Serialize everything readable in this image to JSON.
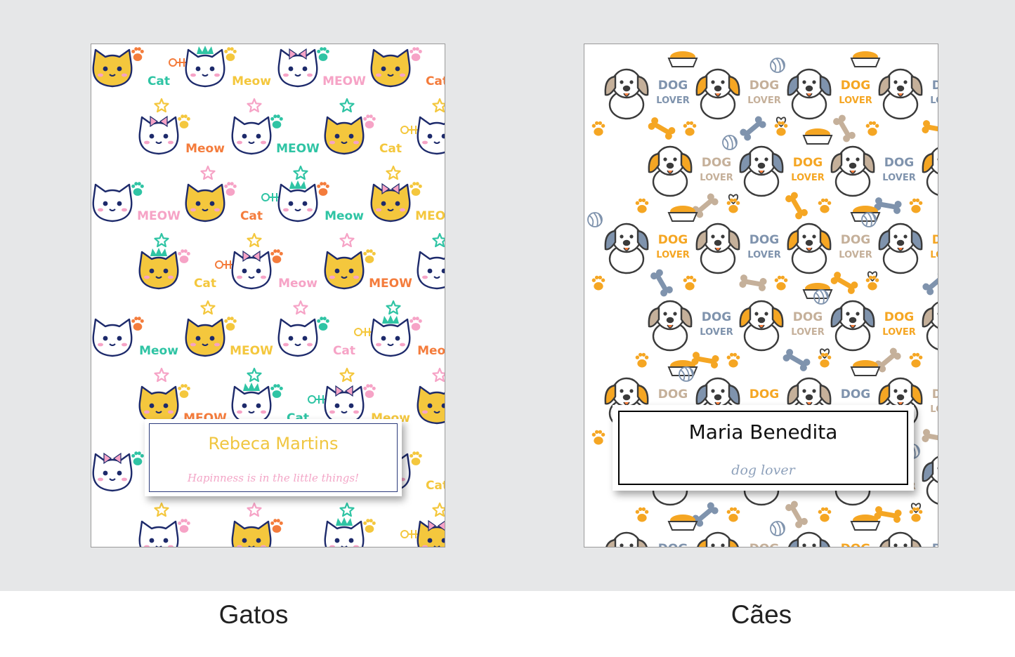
{
  "cats": {
    "caption": "Gatos",
    "label_name": "Rebeca Martins",
    "label_subtitle": "Hapinness is in the little things!",
    "pattern_words": [
      "Cat",
      "Meow",
      "MEOW"
    ],
    "colors": {
      "yellow": "#f4c73d",
      "navy": "#1d2a6b",
      "teal": "#2fc4a4",
      "pink": "#f6a3c6",
      "orange": "#f47c3c"
    }
  },
  "dogs": {
    "caption": "Cães",
    "label_name": "Maria Benedita",
    "label_subtitle": "dog lover",
    "pattern_words": [
      "DOG",
      "LOVER"
    ],
    "colors": {
      "orange": "#f5a623",
      "slate": "#7f93ad",
      "tan": "#c5b09a",
      "outline": "#3b3b3b"
    }
  }
}
